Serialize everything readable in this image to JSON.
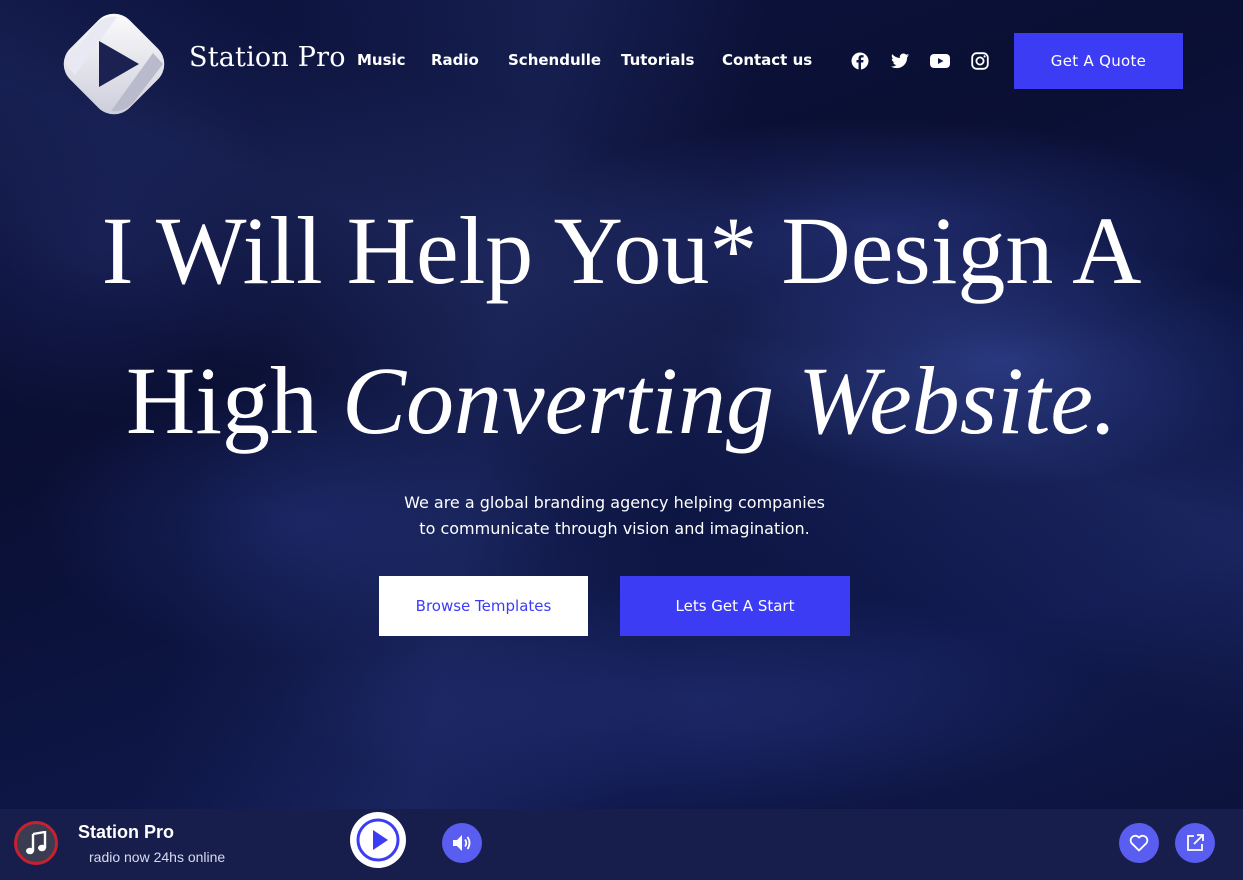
{
  "header": {
    "brand": "Station Pro",
    "nav": [
      {
        "label": "Music"
      },
      {
        "label": "Radio"
      },
      {
        "label": "Schendulle"
      },
      {
        "label": "Tutorials"
      },
      {
        "label": "Contact us"
      }
    ],
    "social_icons": [
      "facebook-icon",
      "twitter-icon",
      "youtube-icon",
      "instagram-icon"
    ],
    "cta_label": "Get A Quote"
  },
  "hero": {
    "headline_line1": "I Will Help You* Design A",
    "headline_line2_plain": "High",
    "headline_line2_italic": "Converting Website.",
    "subtext_line1": "We are a global branding agency helping companies",
    "subtext_line2": "to communicate through vision and imagination.",
    "browse_label": "Browse Templates",
    "start_label": "Lets Get A Start"
  },
  "player": {
    "station_name": "Station Pro",
    "station_subtitle": "radio now 24hs online"
  },
  "colors": {
    "accent": "#3d3cf5",
    "player_bg": "#181e4c",
    "player_button": "#5a5ef0",
    "album_ring": "#c7202f"
  }
}
